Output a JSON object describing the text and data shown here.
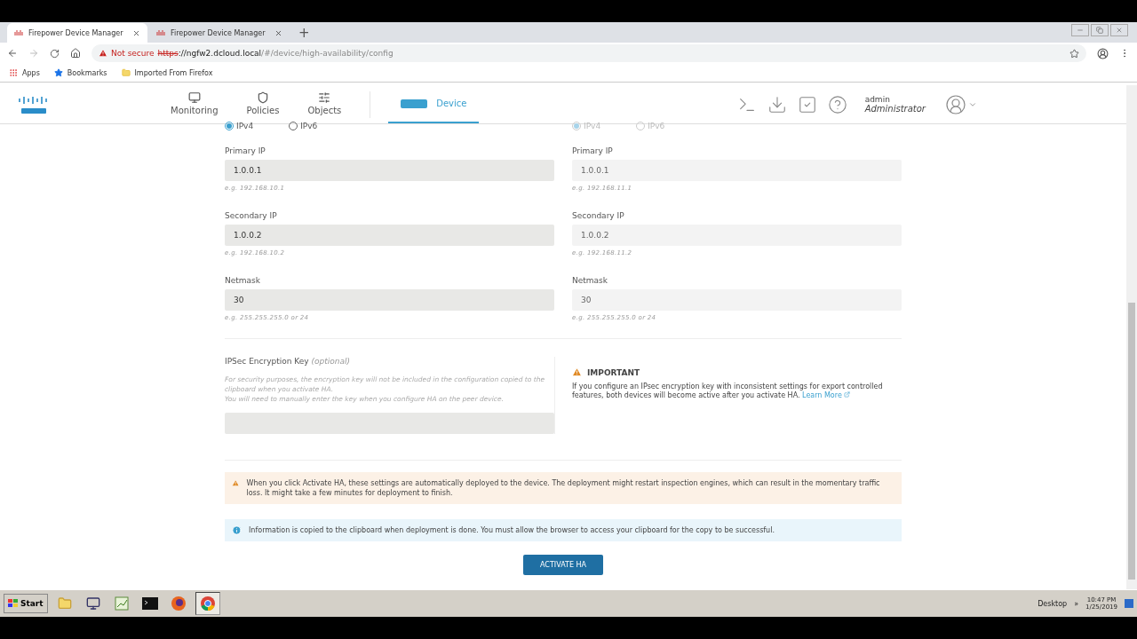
{
  "browser": {
    "tabs": [
      {
        "title": "Firepower Device Manager",
        "selected": true
      },
      {
        "title": "Firepower Device Manager",
        "selected": false
      }
    ],
    "new_tab": "+",
    "address": {
      "warning": "Not secure",
      "scheme": "https",
      "rest": "://ngfw2.dcloud.local",
      "path": "/#/device/high-availability/config"
    },
    "bookmarks": [
      {
        "kind": "apps",
        "label": "Apps"
      },
      {
        "kind": "star",
        "label": "Bookmarks"
      },
      {
        "kind": "folder",
        "label": "Imported From Firefox"
      }
    ]
  },
  "header": {
    "nav": [
      {
        "kind": "monitor",
        "label": "Monitoring",
        "selected": false
      },
      {
        "kind": "policies",
        "label": "Policies",
        "selected": false
      },
      {
        "kind": "objects",
        "label": "Objects",
        "selected": false
      },
      {
        "kind": "device",
        "label": "Device",
        "selected": true
      }
    ],
    "user": {
      "name": "admin",
      "role": "Administrator"
    }
  },
  "columns": [
    {
      "disabled": false,
      "ip_version": [
        {
          "label": "IPv4",
          "selected": true
        },
        {
          "label": "IPv6",
          "selected": false
        }
      ],
      "fields": [
        {
          "label": "Primary IP",
          "value": "1.0.0.1",
          "hint": "e.g. 192.168.10.1"
        },
        {
          "label": "Secondary IP",
          "value": "1.0.0.2",
          "hint": "e.g. 192.168.10.2"
        },
        {
          "label": "Netmask",
          "value": "30",
          "hint": "e.g. 255.255.255.0 or 24"
        }
      ]
    },
    {
      "disabled": true,
      "ip_version": [
        {
          "label": "IPv4",
          "selected": true
        },
        {
          "label": "IPv6",
          "selected": false
        }
      ],
      "fields": [
        {
          "label": "Primary IP",
          "value": "1.0.0.1",
          "hint": "e.g. 192.168.11.1"
        },
        {
          "label": "Secondary IP",
          "value": "1.0.0.2",
          "hint": "e.g. 192.168.11.2"
        },
        {
          "label": "Netmask",
          "value": "30",
          "hint": "e.g. 255.255.255.0 or 24"
        }
      ]
    }
  ],
  "ipsec": {
    "label": "IPSec Encryption Key",
    "optional": "(optional)",
    "help": [
      "For security purposes, the encryption key will not be included in the configuration copied to the clipboard when you activate HA.",
      "You will need to manually enter the key when you configure HA on the peer device."
    ],
    "important_title": "IMPORTANT",
    "important_text": "If you configure an IPsec encryption key with inconsistent settings for export controlled features, both devices will become active after you activate HA.",
    "learn_more": "Learn More"
  },
  "notices": [
    {
      "kind": "warning",
      "text": "When you click Activate HA, these settings are automatically deployed to the device. The deployment might restart inspection engines, which can result in the momentary traffic loss. It might take a few minutes for deployment to finish."
    },
    {
      "kind": "info",
      "text": "Information is copied to the clipboard when deployment is done. You must allow the browser to access your clipboard for the copy to be successful."
    }
  ],
  "action": "ACTIVATE HA",
  "taskbar": {
    "start": "Start",
    "desktop": "Desktop",
    "chevron": "»",
    "time": "10:47 PM",
    "date": "1/25/2019"
  }
}
